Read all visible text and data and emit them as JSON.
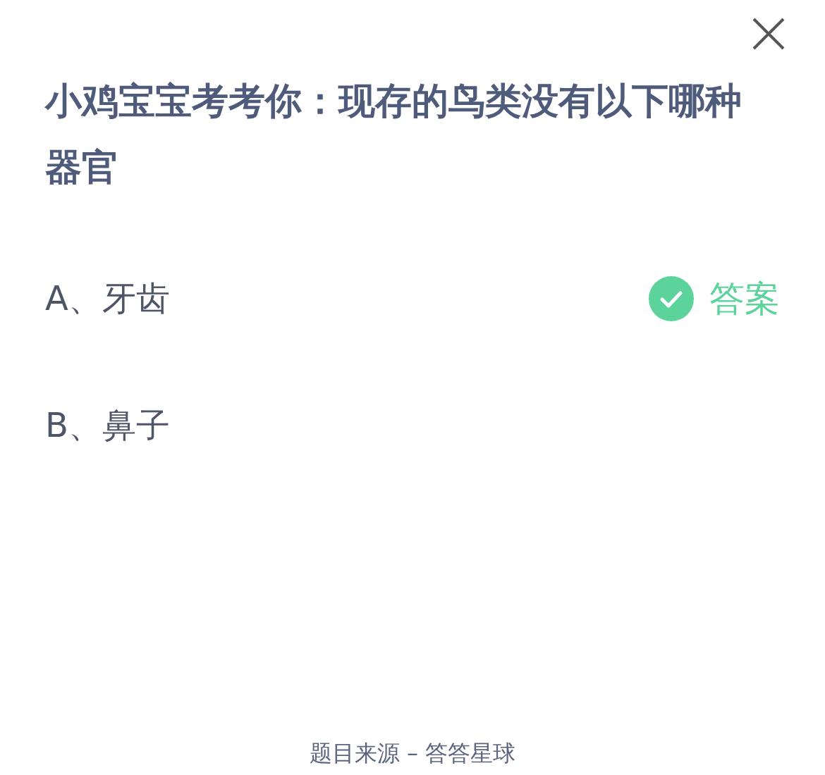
{
  "question": "小鸡宝宝考考你：现存的鸟类没有以下哪种器官",
  "options": [
    {
      "label": "A、牙齿",
      "answer": true
    },
    {
      "label": "B、鼻子",
      "answer": false
    }
  ],
  "answer_badge": "答案",
  "footer": "题目来源 – 答答星球"
}
